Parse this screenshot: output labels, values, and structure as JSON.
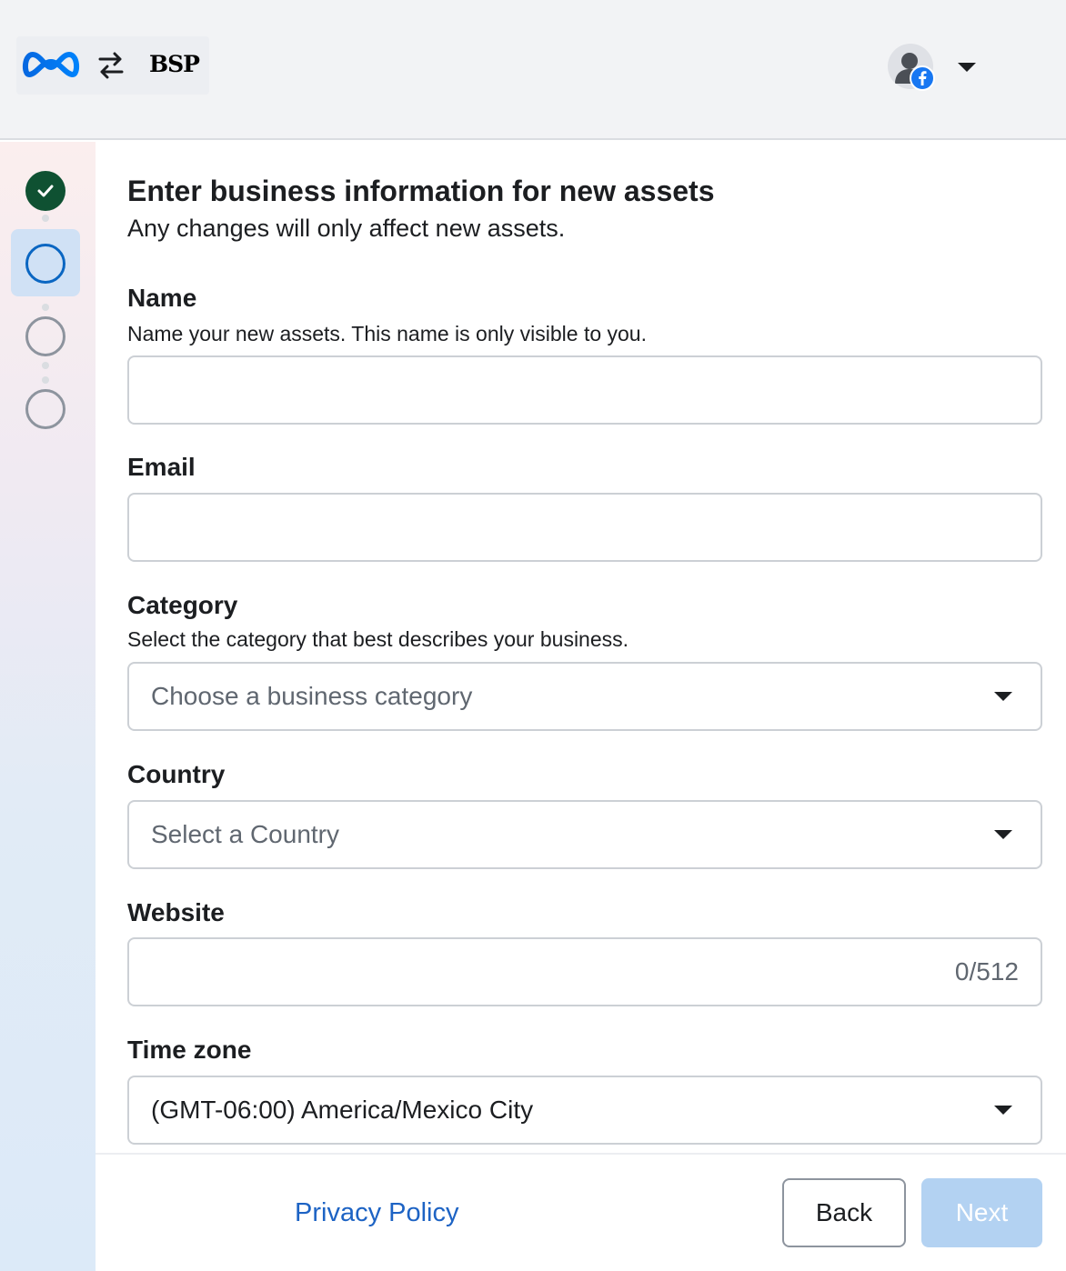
{
  "header": {
    "bsp_logo_text": "BSP"
  },
  "sidebar": {
    "steps": [
      {
        "state": "completed"
      },
      {
        "state": "active"
      },
      {
        "state": "upcoming"
      },
      {
        "state": "upcoming"
      }
    ]
  },
  "form": {
    "title": "Enter business information for new assets",
    "subtitle": "Any changes will only affect new assets.",
    "name": {
      "label": "Name",
      "description": "Name your new assets. This name is only visible to you.",
      "value": ""
    },
    "email": {
      "label": "Email",
      "value": ""
    },
    "category": {
      "label": "Category",
      "description": "Select the category that best describes your business.",
      "placeholder": "Choose a business category"
    },
    "country": {
      "label": "Country",
      "placeholder": "Select a Country"
    },
    "website": {
      "label": "Website",
      "value": "",
      "counter": "0/512"
    },
    "timezone": {
      "label": "Time zone",
      "value": "(GMT-06:00) America/Mexico City"
    }
  },
  "footer": {
    "privacy_label": "Privacy Policy",
    "back_label": "Back",
    "next_label": "Next"
  },
  "colors": {
    "accent": "#0a66c2",
    "completed_step": "#0f5132",
    "link": "#1d63c4",
    "next_disabled": "#b3d2f2",
    "facebook": "#1877f2"
  }
}
